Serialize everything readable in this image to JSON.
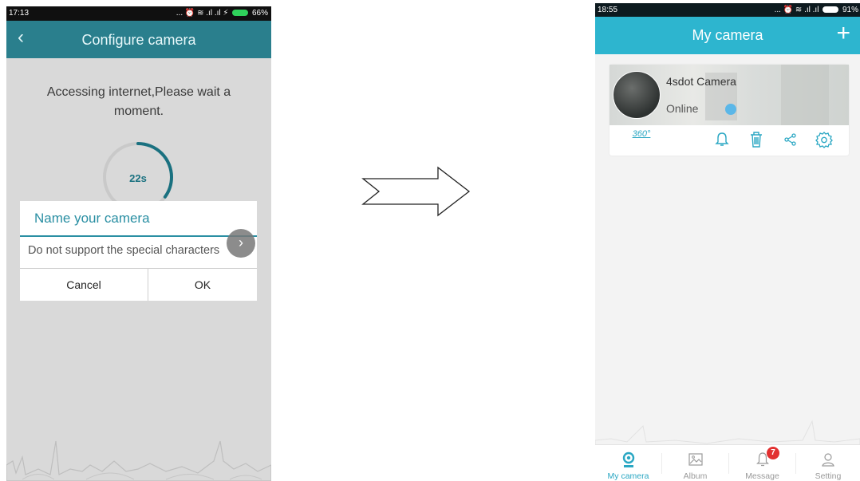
{
  "left_screen": {
    "status_bar": {
      "time": "17:13",
      "icons": "... ⏰ ≋ .ıl .ıl ⚡",
      "battery": "66%"
    },
    "header": {
      "back_label": "‹",
      "title": "Configure camera"
    },
    "message": "Accessing internet,Please wait a moment.",
    "countdown": {
      "text": "22s",
      "progress": 0.35
    },
    "dialog": {
      "title": "Name your camera",
      "input_placeholder": "Do not support the special characters",
      "cancel_label": "Cancel",
      "ok_label": "OK"
    },
    "next_button_label": "›",
    "colors": {
      "header": "#2a7f8d",
      "accent": "#2a8fa3"
    }
  },
  "right_screen": {
    "status_bar": {
      "time": "18:55",
      "icons": "... ⏰ ≋ .ıl .ıl",
      "battery": "91%"
    },
    "header": {
      "title": "My camera",
      "add_label": "+"
    },
    "camera": {
      "name": "4sdot Camera",
      "status": "Online",
      "actions": [
        {
          "name": "360-view",
          "label": "360°"
        },
        {
          "name": "alarm",
          "icon": "bell-icon"
        },
        {
          "name": "delete",
          "icon": "trash-icon"
        },
        {
          "name": "share",
          "icon": "share-icon"
        },
        {
          "name": "settings",
          "icon": "gear-icon"
        }
      ]
    },
    "nav": [
      {
        "label": "My camera",
        "icon": "camera-pin-icon",
        "active": true
      },
      {
        "label": "Album",
        "icon": "image-icon",
        "active": false
      },
      {
        "label": "Message",
        "icon": "bell-icon",
        "active": false,
        "badge": "7"
      },
      {
        "label": "Setting",
        "icon": "person-icon",
        "active": false
      }
    ],
    "colors": {
      "header": "#2db5cf",
      "accent": "#2aa7c3",
      "badge": "#e23030"
    }
  }
}
